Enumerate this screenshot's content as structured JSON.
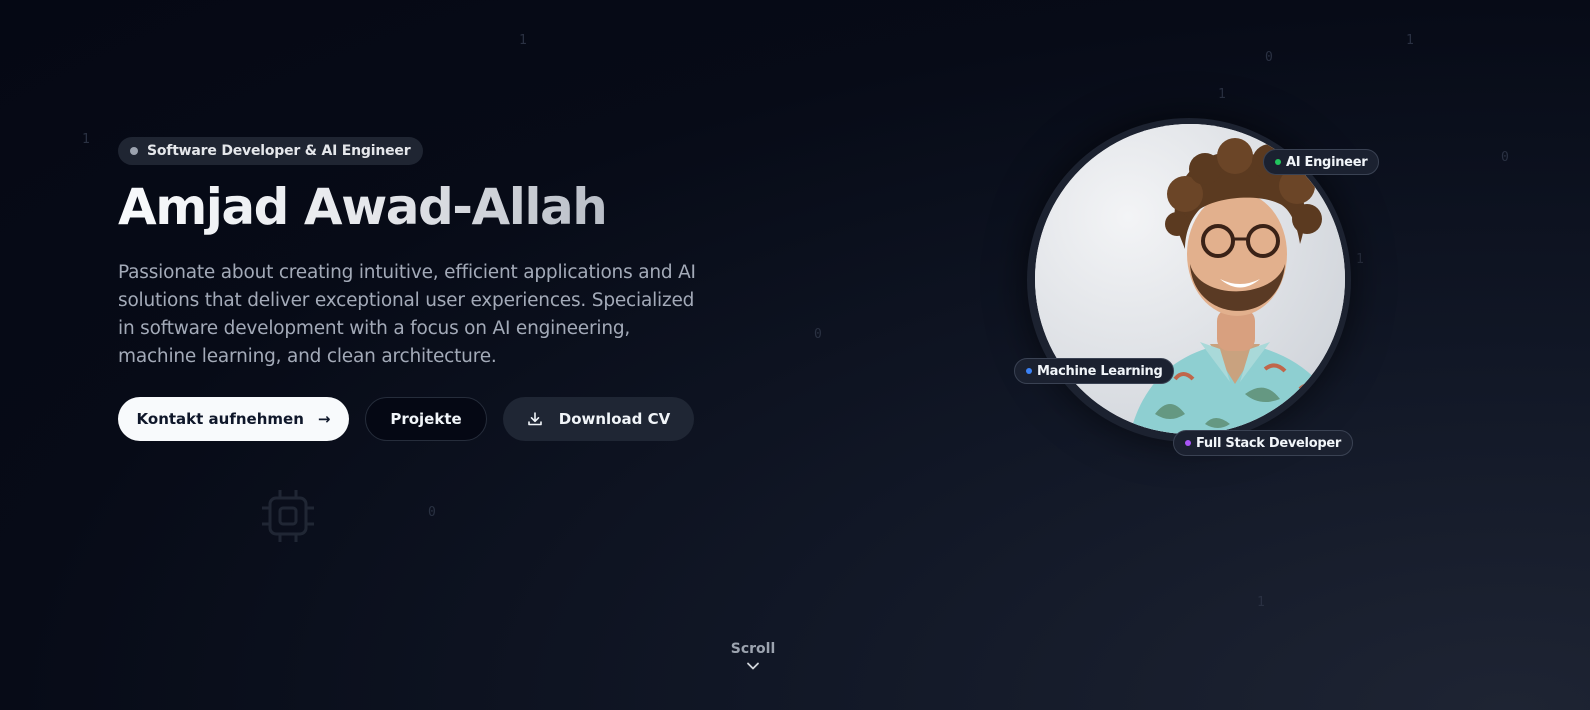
{
  "hero": {
    "badge_label": "Software Developer & AI Engineer",
    "name": "Amjad Awad-Allah",
    "description": "Passionate about creating intuitive, efficient applications and AI solutions that deliver exceptional user experiences. Specialized in software development with a focus on AI engineering, machine learning, and clean architecture."
  },
  "actions": {
    "contact_label": "Kontakt aufnehmen",
    "contact_arrow": "→",
    "projects_label": "Projekte",
    "download_label": "Download CV"
  },
  "portrait_tags": {
    "ai_engineer": "AI Engineer",
    "machine_learning": "Machine Learning",
    "full_stack": "Full Stack Developer"
  },
  "scroll_label": "Scroll",
  "colors": {
    "ai_engineer_dot": "#22c55e",
    "machine_learning_dot": "#3b82f6",
    "full_stack_dot": "#a855f7"
  },
  "icons": [
    "download-icon",
    "chevron-down-icon",
    "chip-icon"
  ]
}
